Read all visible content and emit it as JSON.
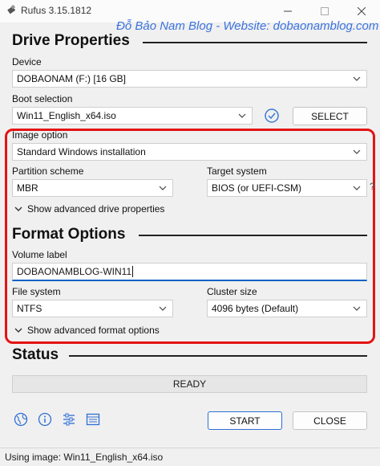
{
  "window": {
    "title": "Rufus 3.15.1812"
  },
  "watermark": "Đỗ Bảo Nam Blog - Website: dobaonamblog.com",
  "drive_properties": {
    "heading": "Drive Properties",
    "device_label": "Device",
    "device_value": "DOBAONAM (F:) [16 GB]",
    "boot_label": "Boot selection",
    "boot_value": "Win11_English_x64.iso",
    "select_button": "SELECT",
    "image_option_label": "Image option",
    "image_option_value": "Standard Windows installation",
    "partition_label": "Partition scheme",
    "partition_value": "MBR",
    "target_label": "Target system",
    "target_value": "BIOS (or UEFI-CSM)",
    "target_help": "?",
    "advanced": "Show advanced drive properties"
  },
  "format_options": {
    "heading": "Format Options",
    "volume_label": "Volume label",
    "volume_value": "DOBAONAMBLOG-WIN11",
    "fs_label": "File system",
    "fs_value": "NTFS",
    "cluster_label": "Cluster size",
    "cluster_value": "4096 bytes (Default)",
    "advanced": "Show advanced format options"
  },
  "status": {
    "heading": "Status",
    "progress_text": "READY"
  },
  "actions": {
    "start": "START",
    "close": "CLOSE"
  },
  "toolbar_icons": [
    "globe-icon",
    "info-icon",
    "settings-icon",
    "log-icon"
  ],
  "status_bar": {
    "text": "Using image: Win11_English_x64.iso"
  },
  "colors": {
    "highlight": "#e31414",
    "watermark": "#3b73e0",
    "focus": "#0a62c7"
  }
}
